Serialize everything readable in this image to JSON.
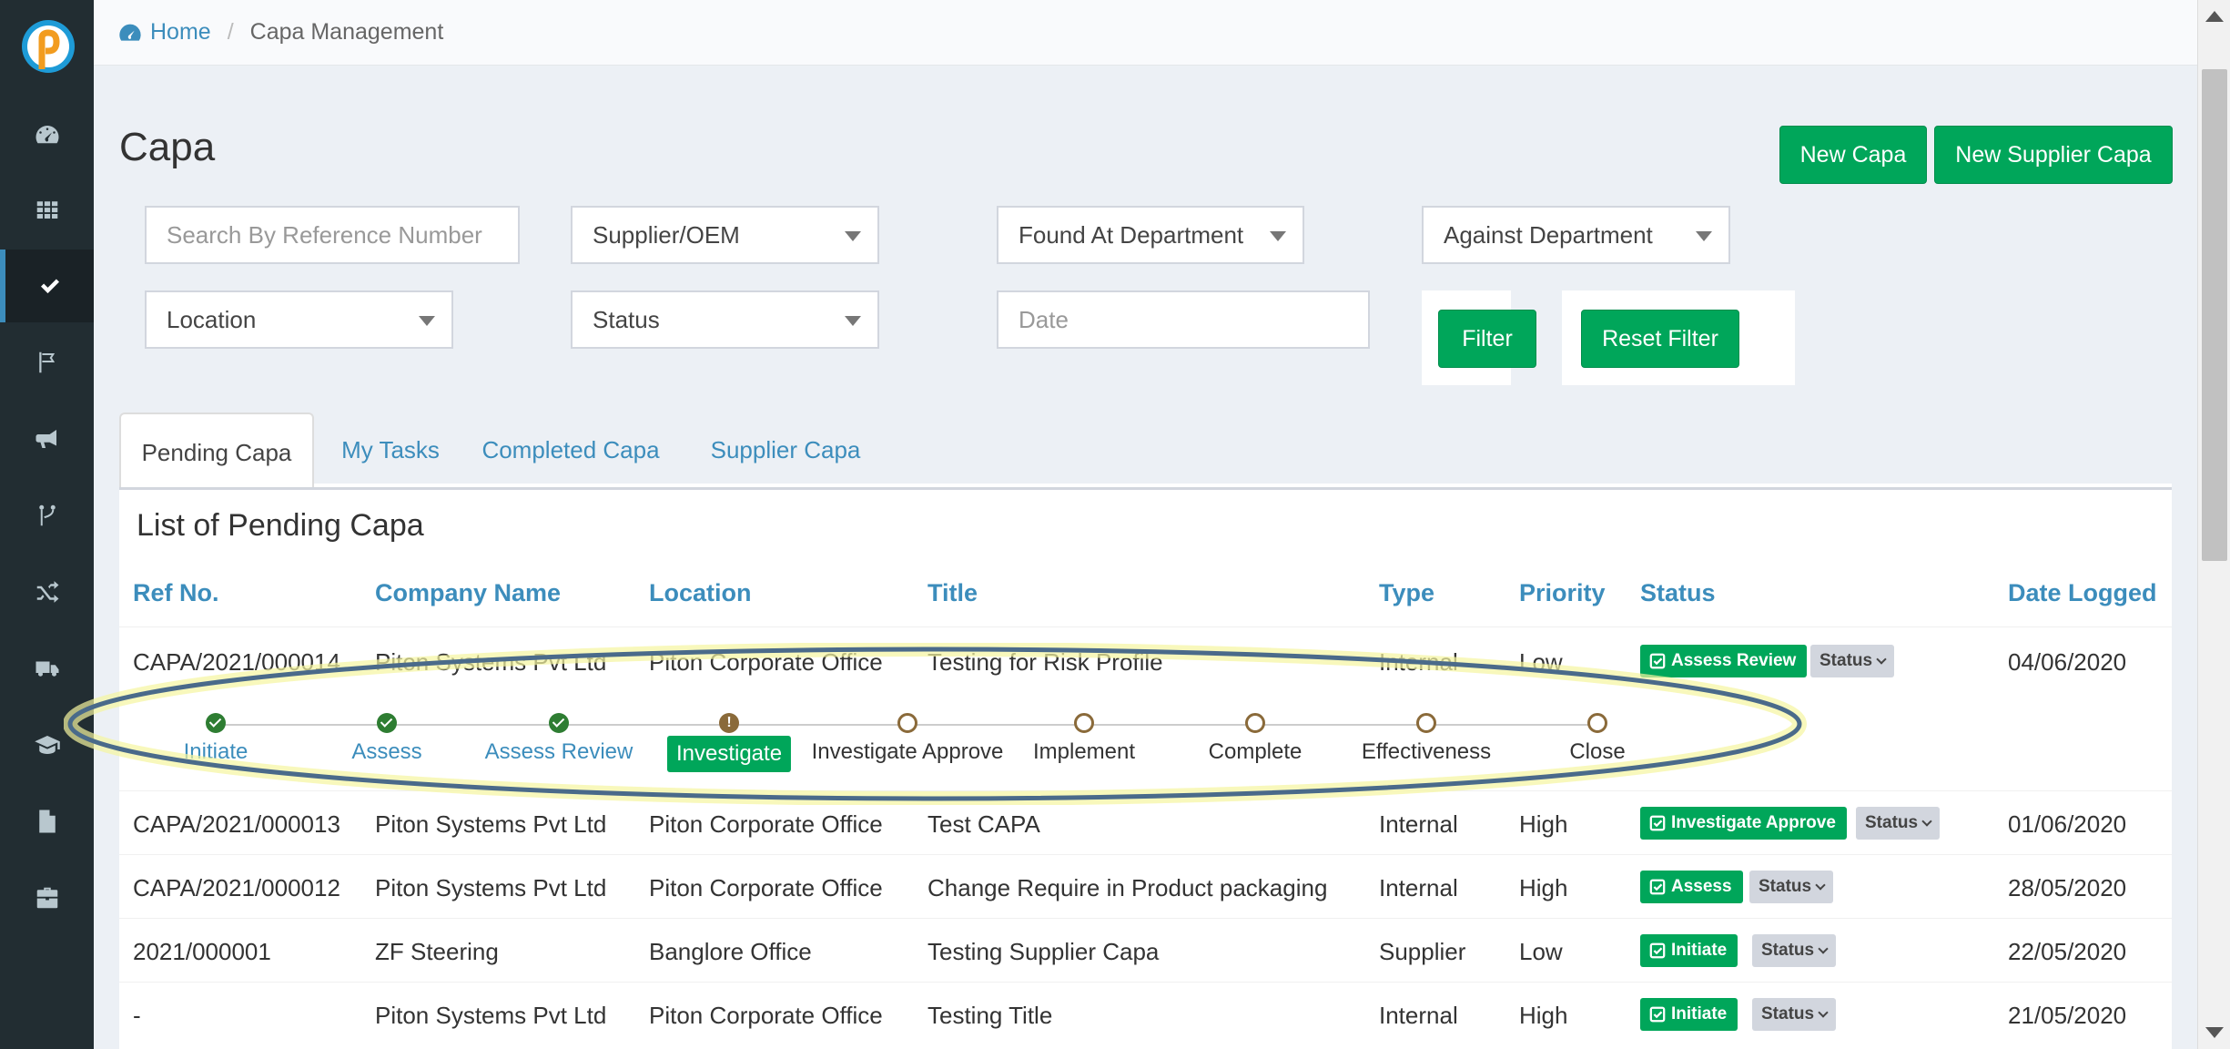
{
  "breadcrumb": {
    "home": "Home",
    "current": "Capa Management"
  },
  "page_title": "Capa",
  "header_buttons": {
    "new_capa": "New Capa",
    "new_supplier_capa": "New Supplier Capa"
  },
  "filters": {
    "search_placeholder": "Search By Reference Number",
    "supplier": "Supplier/OEM",
    "found_at": "Found At Department",
    "against": "Against Department",
    "location": "Location",
    "status": "Status",
    "date_placeholder": "Date",
    "filter_btn": "Filter",
    "reset_btn": "Reset Filter"
  },
  "tabs": [
    "Pending Capa",
    "My Tasks",
    "Completed Capa",
    "Supplier Capa"
  ],
  "panel_title": "List of Pending Capa",
  "columns": [
    "Ref No.",
    "Company Name",
    "Location",
    "Title",
    "Type",
    "Priority",
    "Status",
    "Date Logged"
  ],
  "rows": [
    {
      "ref": "CAPA/2021/000014",
      "company": "Piton Systems Pvt Ltd",
      "location": "Piton Corporate Office",
      "title": "Testing for Risk Profile",
      "type": "Internal",
      "priority": "Low",
      "status": "Assess Review",
      "status_menu": "Status",
      "date": "04/06/2020"
    },
    {
      "ref": "CAPA/2021/000013",
      "company": "Piton Systems Pvt Ltd",
      "location": "Piton Corporate Office",
      "title": "Test CAPA",
      "type": "Internal",
      "priority": "High",
      "status": "Investigate Approve",
      "status_menu": "Status",
      "date": "01/06/2020"
    },
    {
      "ref": "CAPA/2021/000012",
      "company": "Piton Systems Pvt Ltd",
      "location": "Piton Corporate Office",
      "title": "Change Require in Product packaging",
      "type": "Internal",
      "priority": "High",
      "status": "Assess",
      "status_menu": "Status",
      "date": "28/05/2020"
    },
    {
      "ref": "2021/000001",
      "company": "ZF Steering",
      "location": "Banglore Office",
      "title": "Testing Supplier Capa",
      "type": "Supplier",
      "priority": "Low",
      "status": "Initiate",
      "status_menu": "Status",
      "date": "22/05/2020"
    },
    {
      "ref": "-",
      "company": "Piton Systems Pvt Ltd",
      "location": "Piton Corporate Office",
      "title": "Testing Title",
      "type": "Internal",
      "priority": "High",
      "status": "Initiate",
      "status_menu": "Status",
      "date": "21/05/2020"
    }
  ],
  "workflow": {
    "steps": [
      "Initiate",
      "Assess",
      "Assess Review",
      "Investigate",
      "Investigate Approve",
      "Implement",
      "Complete",
      "Effectiveness",
      "Close"
    ],
    "current_index": 3
  },
  "colors": {
    "accent": "#3c8dbc",
    "success": "#00a65a",
    "sidebar": "#222d32",
    "highlight": "#4a6a8a"
  }
}
